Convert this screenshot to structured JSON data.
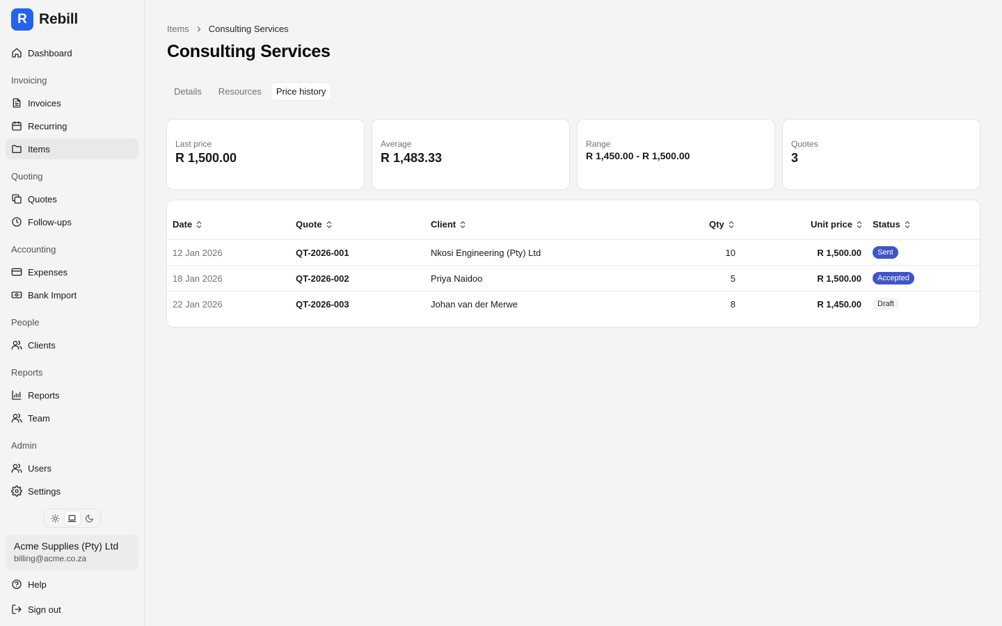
{
  "brand": {
    "logo_letter": "R",
    "name": "Rebill"
  },
  "sidebar": {
    "dashboard": "Dashboard",
    "sections": {
      "invoicing": "Invoicing",
      "quoting": "Quoting",
      "accounting": "Accounting",
      "people": "People",
      "reports": "Reports",
      "admin": "Admin"
    },
    "items": {
      "invoices": "Invoices",
      "recurring": "Recurring",
      "items": "Items",
      "quotes": "Quotes",
      "followups": "Follow-ups",
      "expenses": "Expenses",
      "bank_import": "Bank Import",
      "clients": "Clients",
      "reports": "Reports",
      "team": "Team",
      "users": "Users",
      "settings": "Settings"
    },
    "active_item": "Items",
    "theme_options": [
      "light",
      "system",
      "dark"
    ],
    "theme_selected": "system",
    "org": {
      "name": "Acme Supplies (Pty) Ltd",
      "email": "billing@acme.co.za"
    },
    "help": "Help",
    "sign_out": "Sign out"
  },
  "breadcrumb": {
    "parent": "Items",
    "current": "Consulting Services"
  },
  "page_title": "Consulting Services",
  "tabs": [
    {
      "label": "Details",
      "active": false
    },
    {
      "label": "Resources",
      "active": false
    },
    {
      "label": "Price history",
      "active": true
    }
  ],
  "stats": {
    "last_price": {
      "label": "Last price",
      "value": "R 1,500.00"
    },
    "average": {
      "label": "Average",
      "value": "R 1,483.33"
    },
    "range": {
      "label": "Range",
      "value": "R 1,450.00 - R 1,500.00"
    },
    "quotes": {
      "label": "Quotes",
      "value": "3"
    }
  },
  "table": {
    "columns": {
      "date": "Date",
      "quote": "Quote",
      "client": "Client",
      "qty": "Qty",
      "unit_price": "Unit price",
      "status": "Status"
    },
    "rows": [
      {
        "date": "12 Jan 2026",
        "quote": "QT-2026-001",
        "client": "Nkosi Engineering (Pty) Ltd",
        "qty": "10",
        "unit_price": "R 1,500.00",
        "status": "Sent"
      },
      {
        "date": "18 Jan 2026",
        "quote": "QT-2026-002",
        "client": "Priya Naidoo",
        "qty": "5",
        "unit_price": "R 1,500.00",
        "status": "Accepted"
      },
      {
        "date": "22 Jan 2026",
        "quote": "QT-2026-003",
        "client": "Johan van der Merwe",
        "qty": "8",
        "unit_price": "R 1,450.00",
        "status": "Draft"
      }
    ]
  },
  "colors": {
    "brand": "#2563eb",
    "badge_primary": "#4054c9",
    "badge_neutral": "#f4f4f5"
  }
}
